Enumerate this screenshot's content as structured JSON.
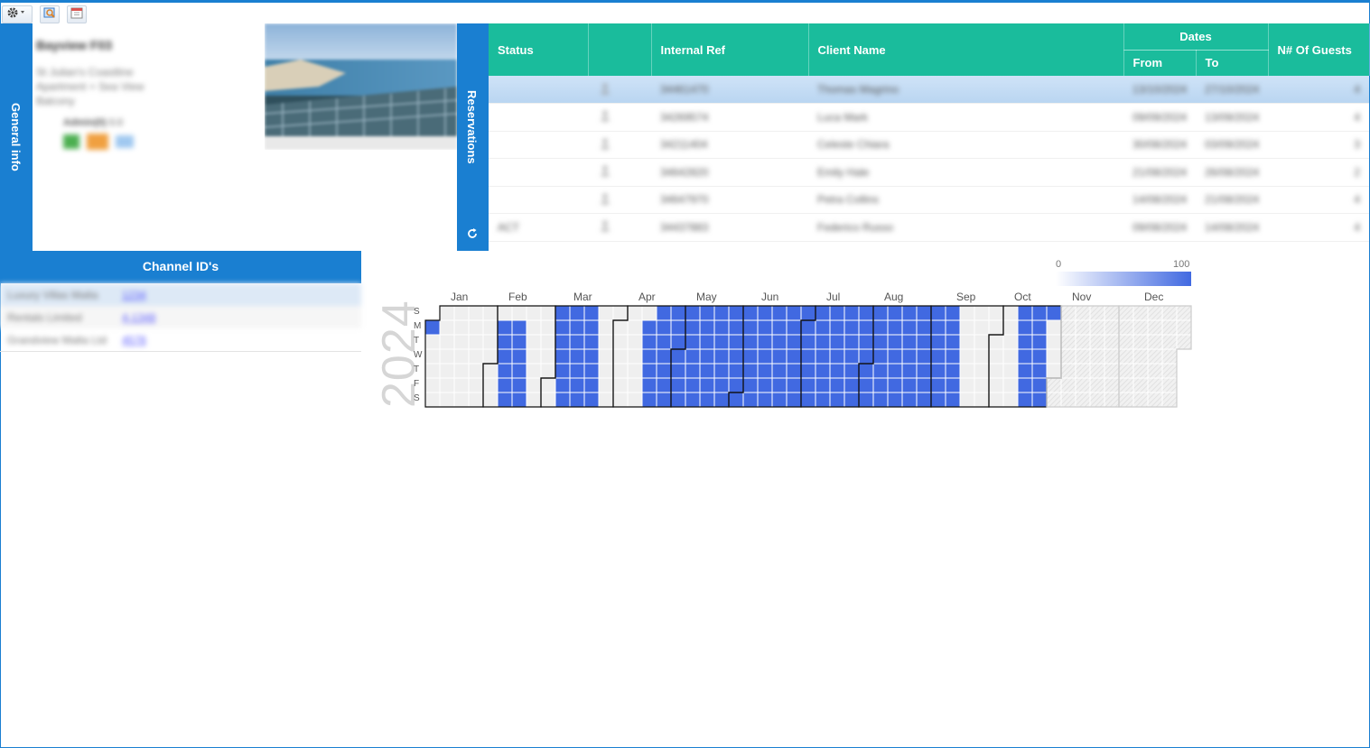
{
  "toolbar": {
    "icons": [
      "gear-icon",
      "search-icon",
      "calendar-icon"
    ]
  },
  "tabs": {
    "general_info": "General info",
    "reservations": "Reservations",
    "channel_ids": "Channel ID's"
  },
  "general_info": {
    "property_name": "Bayview F03",
    "address": "St Julian's Coastline Apartment + Sea View Balcony",
    "rating_label": "Admin(0)",
    "rating_value": "0.0"
  },
  "reservations": {
    "columns": {
      "status": "Status",
      "icon": "",
      "internal_ref": "Internal Ref",
      "client_name": "Client Name",
      "dates": "Dates",
      "from": "From",
      "to": "To",
      "guests": "N# Of Guests"
    },
    "rows": [
      {
        "status": "",
        "ref": "34461470",
        "client": "Thomas Magrino",
        "from": "13/10/2024",
        "to": "27/10/2024",
        "guests": "4"
      },
      {
        "status": "",
        "ref": "34269574",
        "client": "Luca Mark",
        "from": "09/09/2024",
        "to": "13/09/2024",
        "guests": "4"
      },
      {
        "status": "",
        "ref": "34211404",
        "client": "Celeste Chiara",
        "from": "30/08/2024",
        "to": "03/09/2024",
        "guests": "3"
      },
      {
        "status": "",
        "ref": "34642820",
        "client": "Emily Hale",
        "from": "21/08/2024",
        "to": "26/08/2024",
        "guests": "2"
      },
      {
        "status": "",
        "ref": "34647970",
        "client": "Petra Collins",
        "from": "14/08/2024",
        "to": "21/08/2024",
        "guests": "4"
      },
      {
        "status": "ACT",
        "ref": "34437883",
        "client": "Federico Russo",
        "from": "09/08/2024",
        "to": "14/08/2024",
        "guests": "4"
      }
    ]
  },
  "channels": [
    {
      "name": "Luxury Villas Malta",
      "id": "1234"
    },
    {
      "name": "Rentals Limited",
      "id": "4-1348"
    },
    {
      "name": "Grandview Malta Ltd",
      "id": "4578"
    }
  ],
  "heatmap": {
    "year": "2024",
    "legend_min": "0",
    "legend_max": "100",
    "months": [
      "Jan",
      "Feb",
      "Mar",
      "Apr",
      "May",
      "Jun",
      "Jul",
      "Aug",
      "Sep",
      "Oct",
      "Nov",
      "Dec"
    ],
    "weekdays": [
      "S",
      "M",
      "T",
      "W",
      "T",
      "F",
      "S"
    ],
    "fill_color": "#4169e1",
    "empty_color": "#efefef",
    "booked_ranges": [
      [
        "2024-01-01",
        "2024-01-01"
      ],
      [
        "2024-02-05",
        "2024-02-10"
      ],
      [
        "2024-02-12",
        "2024-02-17"
      ],
      [
        "2024-03-03",
        "2024-03-03"
      ],
      [
        "2024-03-04",
        "2024-03-16"
      ],
      [
        "2024-03-17",
        "2024-03-23"
      ],
      [
        "2024-04-15",
        "2024-04-30"
      ],
      [
        "2024-05-01",
        "2024-05-31"
      ],
      [
        "2024-06-01",
        "2024-06-30"
      ],
      [
        "2024-07-01",
        "2024-07-31"
      ],
      [
        "2024-08-01",
        "2024-08-31"
      ],
      [
        "2024-09-01",
        "2024-09-14"
      ],
      [
        "2024-10-13",
        "2024-10-27"
      ]
    ]
  }
}
